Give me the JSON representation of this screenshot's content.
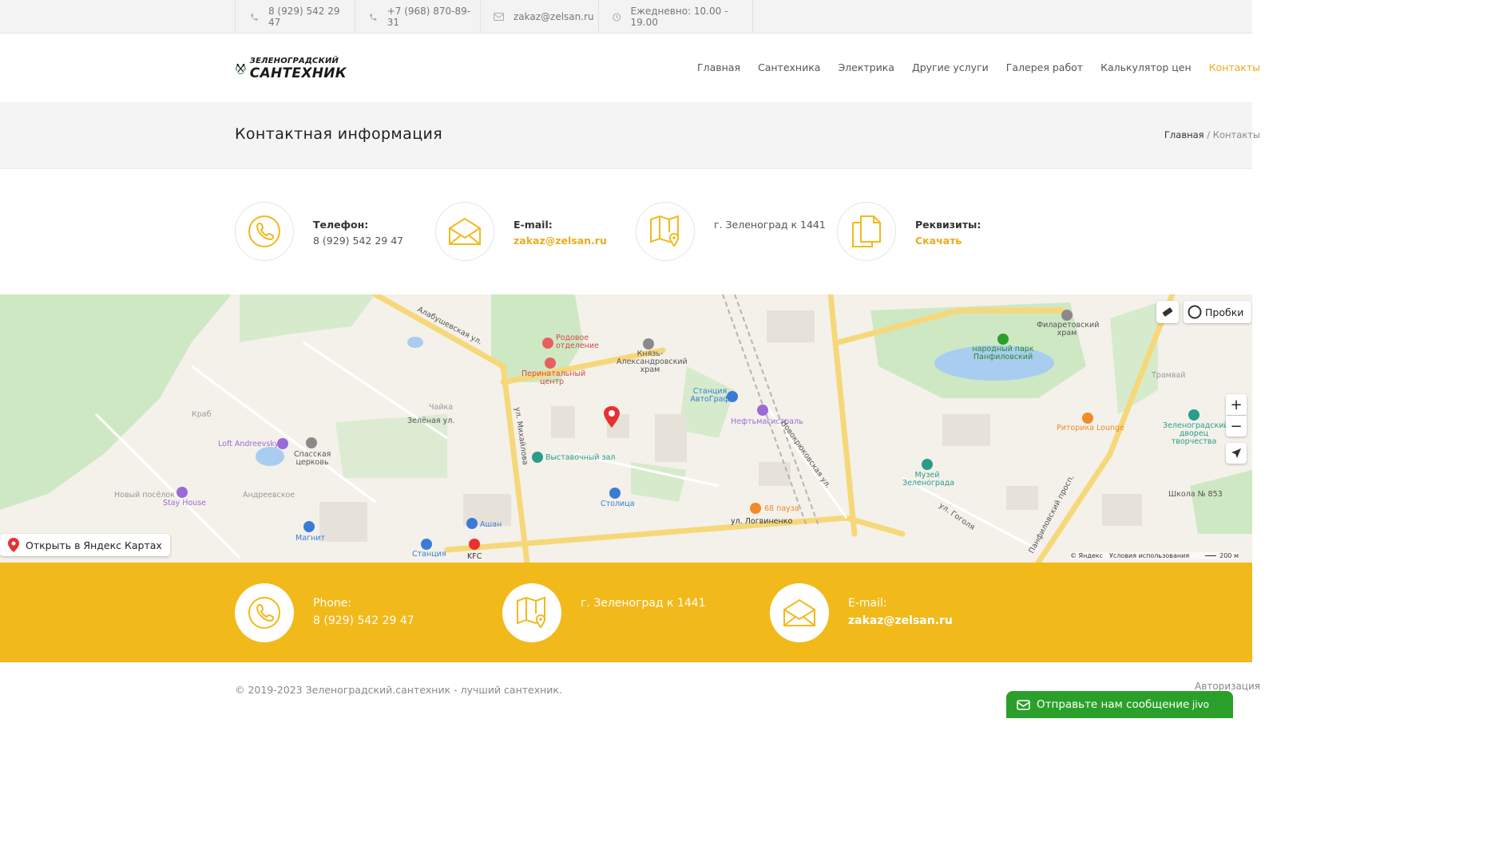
{
  "topbar": {
    "phone1": "8 (929) 542 29 47",
    "phone2": "+7 (968) 870-89-31",
    "email": "zakaz@zelsan.ru",
    "hours": "Ежедневно: 10.00 - 19.00"
  },
  "logo": {
    "line1": "ЗЕЛЕНОГРАДСКИЙ",
    "line2": "САНТЕХНИК"
  },
  "nav": {
    "items": [
      "Главная",
      "Сантехника",
      "Электрика",
      "Другие услуги",
      "Галерея работ",
      "Калькулятор цен",
      "Контакты"
    ],
    "active": "Контакты"
  },
  "page": {
    "title": "Контактная информация"
  },
  "breadcrumb": {
    "home": "Главная",
    "separator": " / ",
    "current": "Контакты"
  },
  "contacts": {
    "phone_label": "Телефон:",
    "phone_value": "8 (929) 542 29 47",
    "email_label": "E-mail:",
    "email_value": "zakaz@zelsan.ru",
    "address": "г. Зеленоград к 1441",
    "requisites_label": "Реквизиты:",
    "requisites_link": "Скачать"
  },
  "map": {
    "open_in_yandex": "Открыть в Яндекс Картах",
    "traffic": "Пробки",
    "zoom_in": "+",
    "zoom_out": "−",
    "copyright": "© Яндекс",
    "terms": "Условия использования",
    "scale": "200 м",
    "labels": [
      "Алабушевская ул.",
      "Родовое отделение",
      "Перинатальный центр",
      "Князь-Александровский храм",
      "Станция АвтоГраф",
      "Нефтьмагистраль",
      "Выставочный зал",
      "Столица",
      "68 пауза",
      "ул. Логвиненко",
      "Ашан",
      "KFC",
      "Станция",
      "Магнит",
      "Loft Andreevsky",
      "Спасская церковь",
      "Stay House",
      "Новый посёлок",
      "Андреевское",
      "Краб",
      "Чайка",
      "Зелёная ул.",
      "ул. Михайлова",
      "Новокрюковская ул.",
      "народный парк Панфиловский",
      "Филаретовский храм",
      "Зеленоградский дворец творчества",
      "Музей Зеленограда",
      "Риторика Lounge",
      "Школа № 853",
      "Панфиловский просп.",
      "ул. Гоголя",
      "Трамвай"
    ]
  },
  "footer": {
    "phone_label": "Phone:",
    "phone_value": "8 (929) 542 29 47",
    "address": "г. Зеленоград к 1441",
    "email_label": "E-mail:",
    "email_value": "zakaz@zelsan.ru"
  },
  "bottom": {
    "copyright": "© 2019-2023 Зеленоградский.сантехник - лучший сантехник.",
    "auth": "Авторизация"
  },
  "chat": {
    "label": "Отправьте нам сообщение",
    "brand": "jivo"
  },
  "colors": {
    "accent": "#f2b91b",
    "accent_text": "#e9ac1b",
    "chat": "#2aa02a"
  }
}
